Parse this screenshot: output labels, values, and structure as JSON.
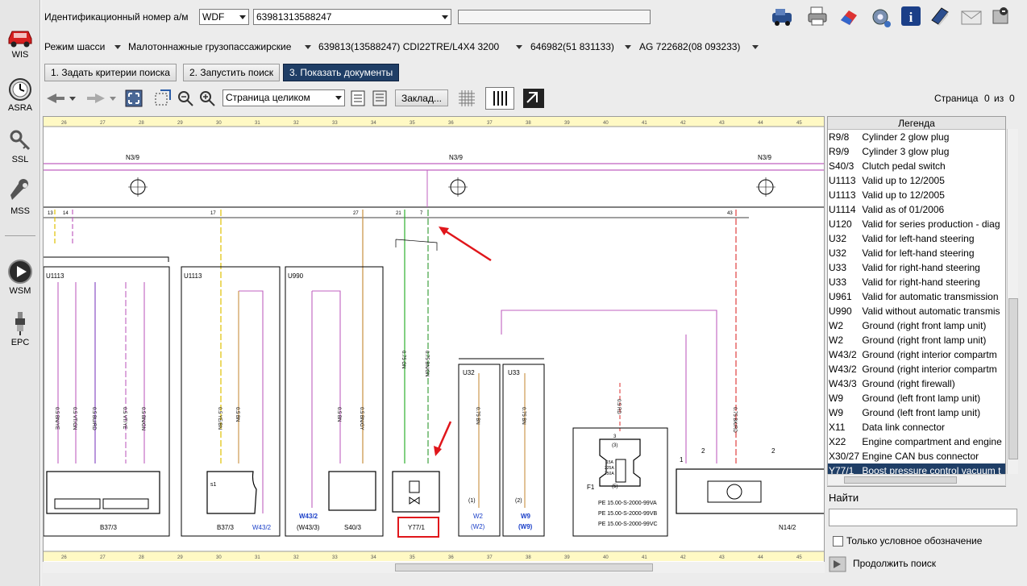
{
  "nav": {
    "items": [
      {
        "label": "WIS",
        "icon": "car-icon"
      },
      {
        "label": "ASRA",
        "icon": "clock-icon"
      },
      {
        "label": "SSL",
        "icon": "key-icon"
      },
      {
        "label": "MSS",
        "icon": "wrench-icon"
      },
      {
        "label": "WSM",
        "icon": "play-icon"
      },
      {
        "label": "EPC",
        "icon": "spark-plug-icon"
      }
    ]
  },
  "header": {
    "vin_label": "Идентификационный номер а/м",
    "vin_type": "WDF",
    "vin_value": "63981313588247",
    "toolbar_icons": [
      "vehicle-icon",
      "print-icon",
      "eraser-icon",
      "settings-gear-icon",
      "info-icon",
      "help-book-icon",
      "mail-icon",
      "exit-icon"
    ]
  },
  "breadcrumb": {
    "items": [
      "Режим шасси",
      "Малотоннажные грузопассажирские",
      "639813(13588247) CDI22TRE/L4X4   3200",
      "646982(51 831133)",
      "AG 722682(08 093233)"
    ]
  },
  "steps": {
    "step1": "1. Задать критерии поиска",
    "step2": "2. Запустить поиск",
    "step3": "3. Показать документы"
  },
  "viewbar": {
    "zoom_select": "Страница целиком",
    "bookmark_button": "Заклад...",
    "page_label": "Страница",
    "page_current": "0",
    "page_of": "из",
    "page_total": "0"
  },
  "diagram": {
    "ruler_numbers": [
      "26",
      "27",
      "28",
      "29",
      "30",
      "31",
      "32",
      "33",
      "34",
      "35",
      "36",
      "37",
      "38",
      "39",
      "40",
      "41",
      "42",
      "43",
      "44",
      "45"
    ],
    "connector_labels": [
      "N3/9",
      "N3/9",
      "N3/9"
    ],
    "pin_labels": [
      "13",
      "14",
      "17",
      "27",
      "21",
      "7",
      "43"
    ],
    "wire_labels": [
      "0.5 BN/YE",
      "0.5 VT/GN",
      "0.5 BU/RD",
      "0.5 VT/YE",
      "0.5 BN/GN",
      "0.5 YE/BN",
      "0.5 BN",
      "0.5 BN",
      "0.5 BN/GY",
      "0.75 GN",
      "0.75 BN/GN",
      "0.75 BN",
      "0.75 BN",
      "0.5 RD",
      "0.75 BK/RD"
    ],
    "box_labels": [
      "U1113",
      "U1113",
      "U990",
      "U32",
      "U33"
    ],
    "component_labels": [
      "B37/3",
      "B37/3",
      "W43/2",
      "W43/2",
      "(W43/3)",
      "S40/3",
      "Y77/1",
      "W2",
      "(W2)",
      "W9",
      "(W9)",
      "F1",
      "N14/2"
    ],
    "fuse_refs": [
      "PE 15.00-S-2000-99VA",
      "PE 15.00-S-2000-99VB",
      "PE 15.00-S-2000-99VC"
    ],
    "fuse_ratings": [
      "15A",
      "225A",
      "250A"
    ],
    "misc_labels": [
      "s1",
      "(1)",
      "(2)",
      "1",
      "2",
      "3",
      "(3)",
      "(5)",
      "1",
      "2"
    ]
  },
  "legend": {
    "title": "Легенда",
    "rows": [
      {
        "code": "R9/8",
        "text": "Cylinder 2 glow plug"
      },
      {
        "code": "R9/9",
        "text": "Cylinder 3 glow plug"
      },
      {
        "code": "S40/3",
        "text": "Clutch pedal switch"
      },
      {
        "code": "U1113",
        "text": "Valid up to 12/2005"
      },
      {
        "code": "U1113",
        "text": "Valid up to 12/2005"
      },
      {
        "code": "U1114",
        "text": "Valid as of 01/2006"
      },
      {
        "code": "U120",
        "text": "Valid for series production - diag"
      },
      {
        "code": "U32",
        "text": "Valid for left-hand steering"
      },
      {
        "code": "U32",
        "text": "Valid for left-hand steering"
      },
      {
        "code": "U33",
        "text": "Valid for right-hand steering"
      },
      {
        "code": "U33",
        "text": "Valid for right-hand steering"
      },
      {
        "code": "U961",
        "text": "Valid for automatic transmission"
      },
      {
        "code": "U990",
        "text": "Valid without automatic transmis"
      },
      {
        "code": "W2",
        "text": "Ground (right front lamp unit)"
      },
      {
        "code": "W2",
        "text": "Ground (right front lamp unit)"
      },
      {
        "code": "W43/2",
        "text": "Ground (right interior compartm"
      },
      {
        "code": "W43/2",
        "text": "Ground (right interior compartm"
      },
      {
        "code": "W43/3",
        "text": "Ground (right firewall)"
      },
      {
        "code": "W9",
        "text": "Ground (left front lamp unit)"
      },
      {
        "code": "W9",
        "text": "Ground (left front lamp unit)"
      },
      {
        "code": "X11",
        "text": "Data link connector"
      },
      {
        "code": "X22",
        "text": "Engine compartment and engine"
      },
      {
        "code": "X30/27",
        "text": "Engine CAN bus connector"
      },
      {
        "code": "Y77/1",
        "text": "Boost pressure control vacuum t"
      }
    ],
    "selected_index": 23
  },
  "search": {
    "find_label": "Найти",
    "checkbox_label": "Только условное обозначение",
    "continue_label": "Продолжить поиск"
  },
  "colors": {
    "accent_dark": "#1f3e66",
    "annotation_red": "#e0161b",
    "ruler_yellow": "#fff9c4"
  }
}
